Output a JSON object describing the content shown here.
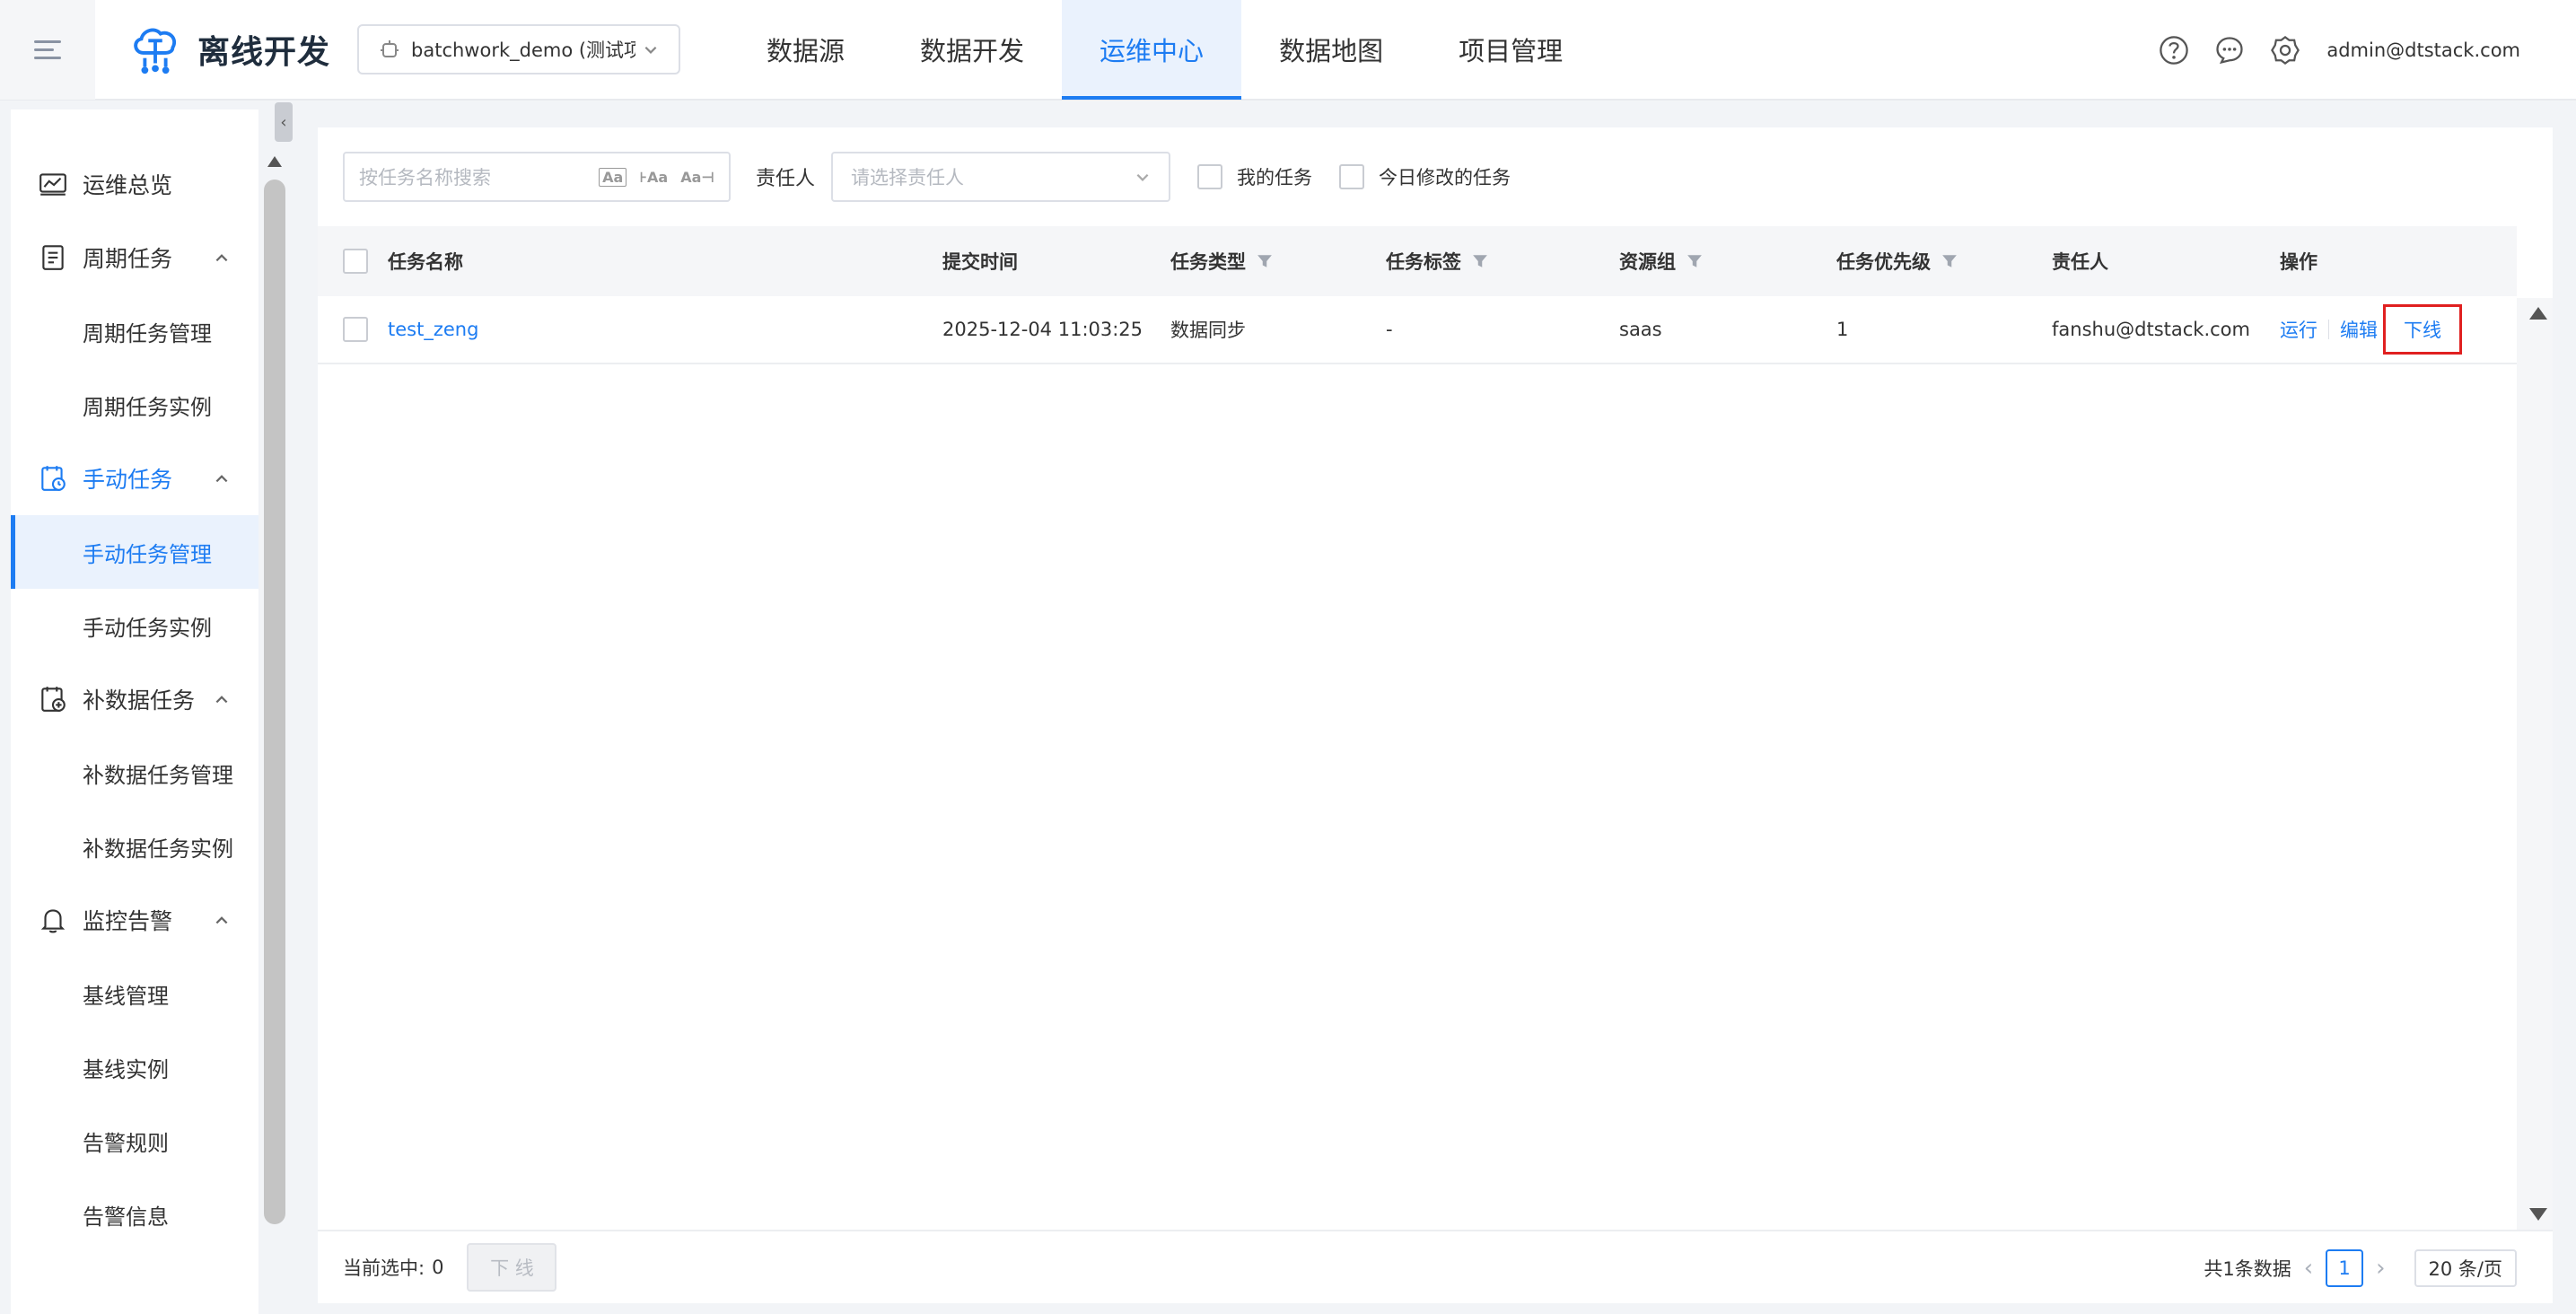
{
  "header": {
    "app_title": "离线开发",
    "project": "batchwork_demo (测试项...",
    "nav": [
      "数据源",
      "数据开发",
      "运维中心",
      "数据地图",
      "项目管理"
    ],
    "active_nav": 2,
    "user": "admin@dtstack.com"
  },
  "sidebar": {
    "overview": "运维总览",
    "groups": [
      {
        "label": "周期任务",
        "items": [
          "周期任务管理",
          "周期任务实例"
        ]
      },
      {
        "label": "手动任务",
        "items": [
          "手动任务管理",
          "手动任务实例"
        ]
      },
      {
        "label": "补数据任务",
        "items": [
          "补数据任务管理",
          "补数据任务实例"
        ]
      },
      {
        "label": "监控告警",
        "items": [
          "基线管理",
          "基线实例",
          "告警规则",
          "告警信息"
        ]
      }
    ],
    "active_group": 1,
    "active_item": "手动任务管理"
  },
  "filters": {
    "search_placeholder": "按任务名称搜索",
    "owner_label": "责任人",
    "owner_placeholder": "请选择责任人",
    "my_tasks": "我的任务",
    "today_modified": "今日修改的任务"
  },
  "table": {
    "columns": {
      "name": "任务名称",
      "submit_time": "提交时间",
      "type": "任务类型",
      "tag": "任务标签",
      "resource": "资源组",
      "priority": "任务优先级",
      "owner": "责任人",
      "actions": "操作"
    },
    "rows": [
      {
        "name": "test_zeng",
        "submit_time": "2025-12-04 11:03:25",
        "type": "数据同步",
        "tag": "-",
        "resource": "saas",
        "priority": "1",
        "owner": "fanshu@dtstack.com",
        "run": "运行",
        "edit": "编辑",
        "offline": "下线"
      }
    ]
  },
  "footer": {
    "selected_label": "当前选中:",
    "selected_count": "0",
    "offline_btn": "下 线",
    "total": "共1条数据",
    "page": "1",
    "page_size": "20 条/页"
  }
}
